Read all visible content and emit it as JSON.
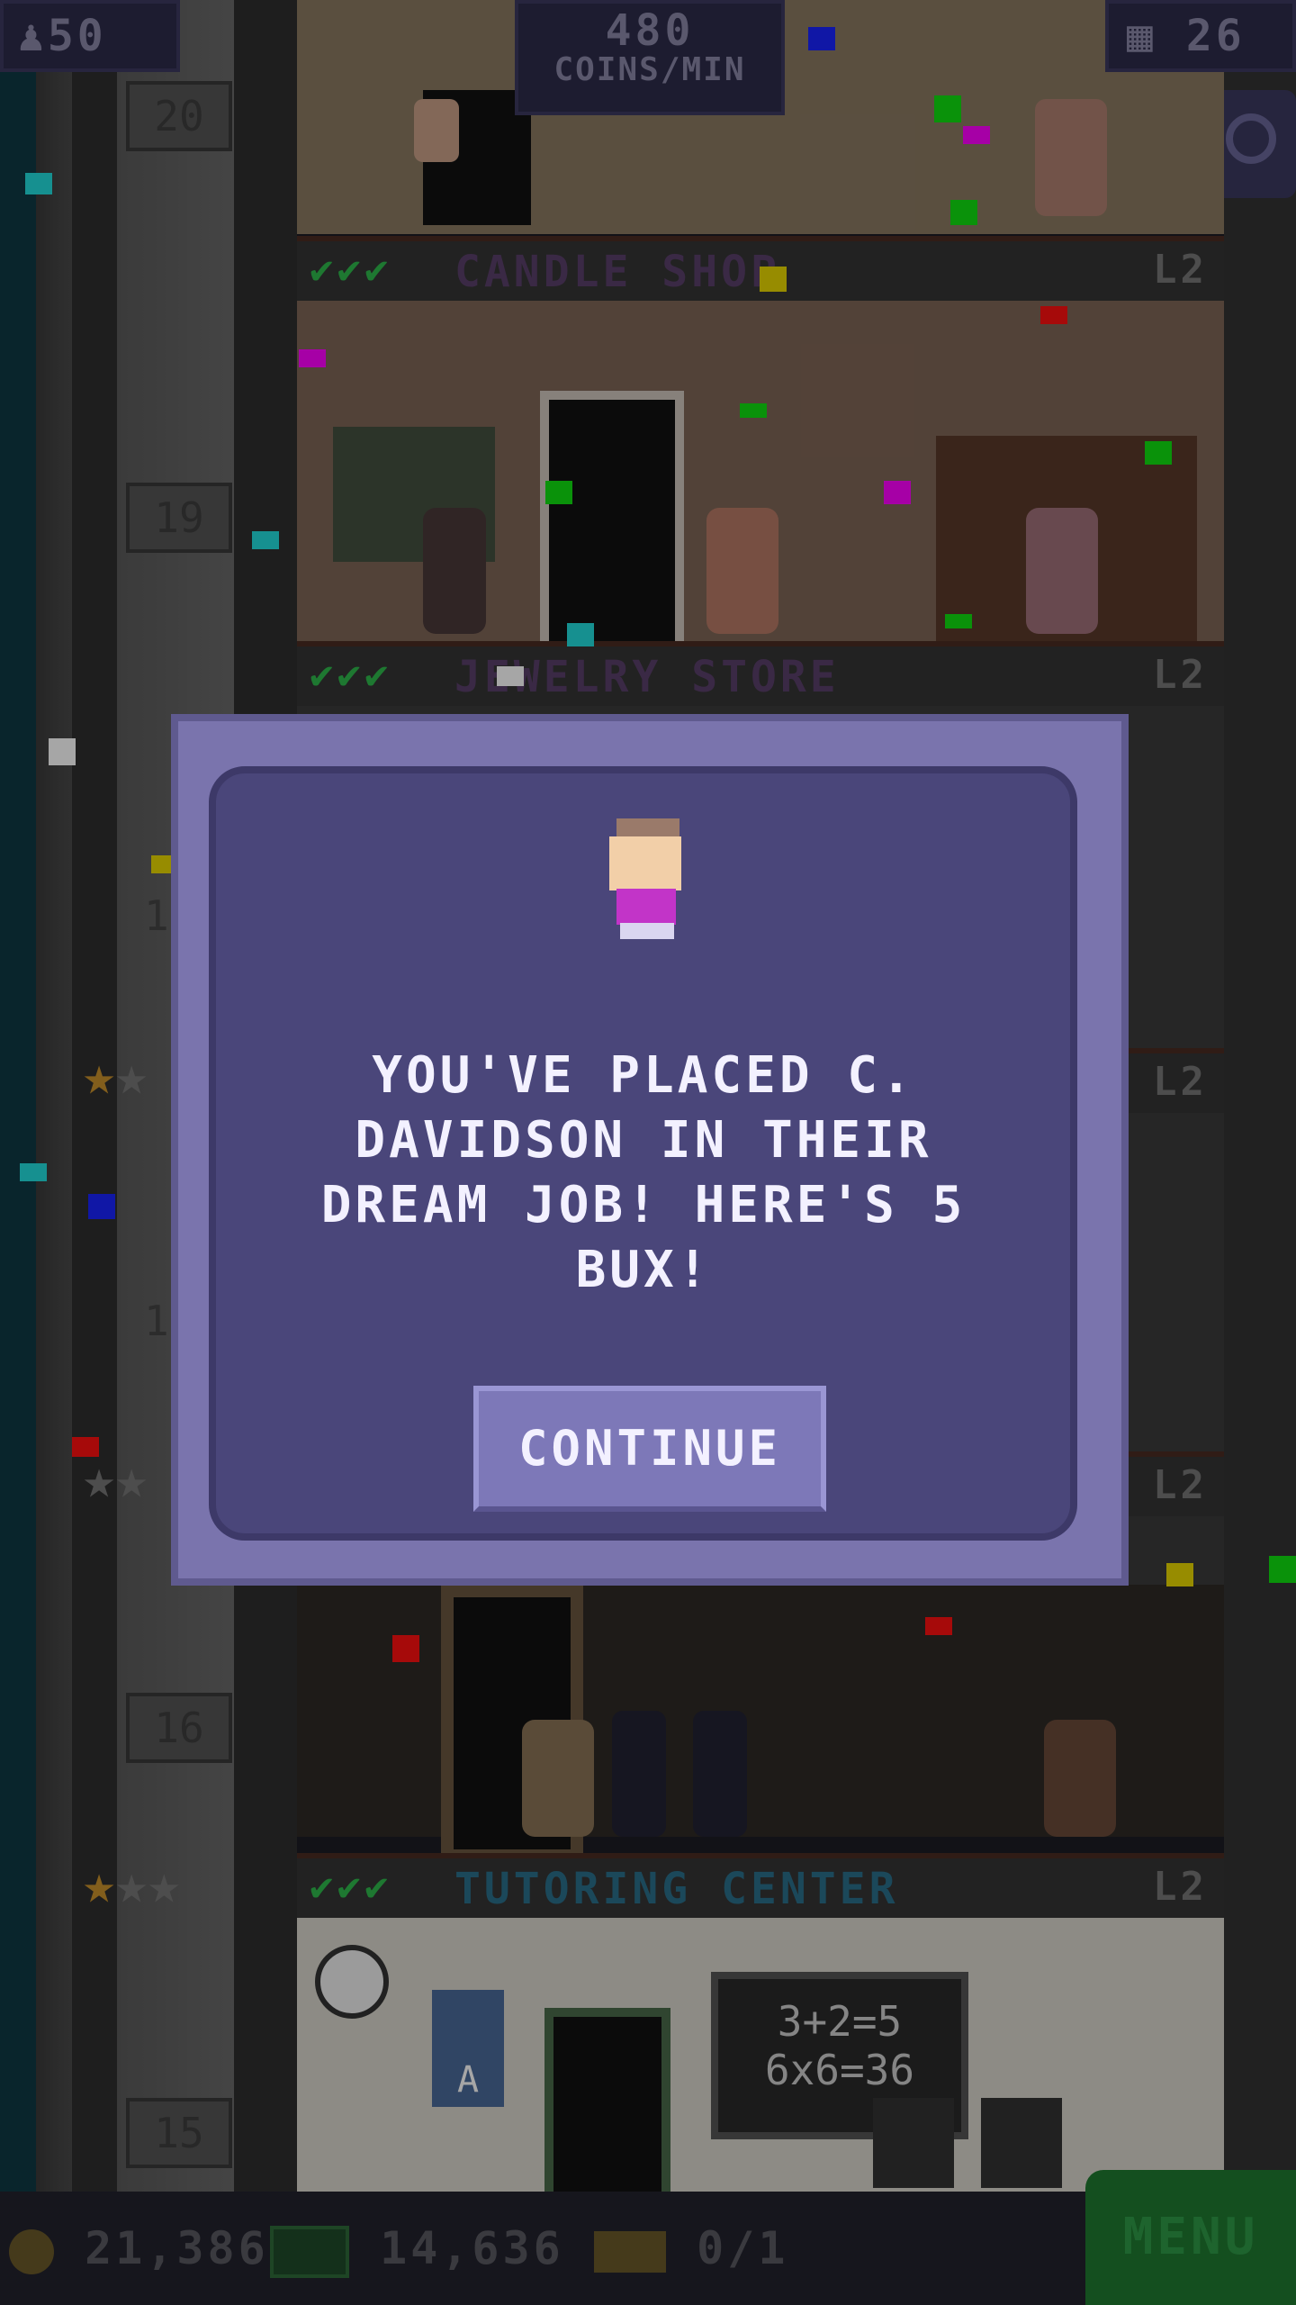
{
  "hud": {
    "population": "50",
    "coins_rate_value": "480",
    "coins_rate_unit": "COINS/MIN",
    "floors_count": "26"
  },
  "floors": [
    {
      "number": "20",
      "name": "",
      "level": ""
    },
    {
      "number": "19",
      "name": "JEWELRY STORE",
      "level": "L2",
      "checks": "✔✔✔"
    },
    {
      "number": "16",
      "name": "TUTORING CENTER",
      "level": "L2",
      "checks": "✔✔✔"
    },
    {
      "number": "15",
      "name": "",
      "level": ""
    }
  ],
  "candle_sign": {
    "name": "CANDLE SHOP",
    "level": "L2",
    "checks": "✔✔✔"
  },
  "other_signs": {
    "level_a": "L2",
    "level_b": "L2"
  },
  "side_labels": {
    "a": "1",
    "b": "1"
  },
  "tutoring": {
    "board_line1": "3+2=5",
    "board_line2": "6x6=36",
    "poster_letter": "A"
  },
  "bottom_bar": {
    "coins": "21,386",
    "bux": "14,636",
    "tickets": "0/1",
    "menu_label": "MENU"
  },
  "dialog": {
    "message": "YOU'VE PLACED C. DAVIDSON IN THEIR DREAM JOB! HERE'S 5 BUX!",
    "continue_label": "CONTINUE"
  },
  "colors": {
    "dialog_bg": "#4a467a",
    "dialog_frame": "#7a74ad",
    "sign_text_candle": "#5a3f6a",
    "sign_text_tutoring": "#2a6f8a",
    "menu_green": "#1f7a30"
  }
}
